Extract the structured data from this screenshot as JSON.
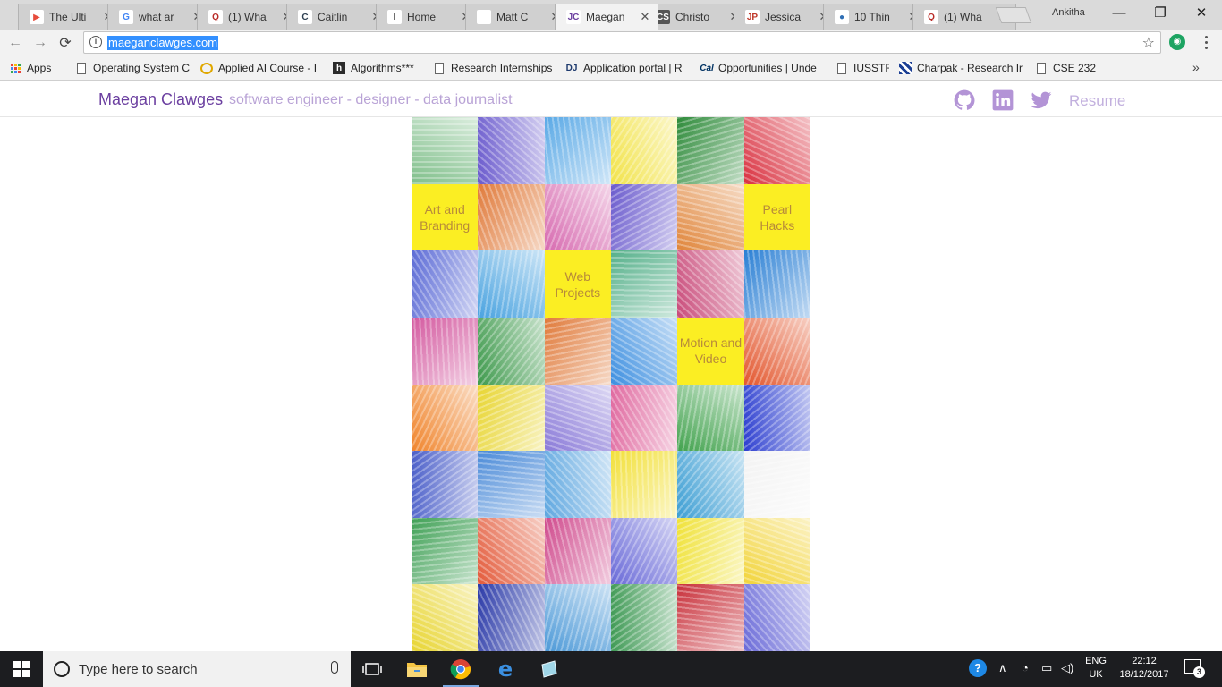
{
  "tabs": [
    {
      "title": "The Ulti",
      "favicon": "▶",
      "favbg": "#ffffff",
      "favcolor": "#e74c3c"
    },
    {
      "title": "what ar",
      "favicon": "G",
      "favbg": "#ffffff",
      "favcolor": "#4285f4"
    },
    {
      "title": "(1) Wha",
      "favicon": "Q",
      "favbg": "#ffffff",
      "favcolor": "#b92b27"
    },
    {
      "title": "Caitlin",
      "favicon": "C",
      "favbg": "#ffffff",
      "favcolor": "#2c3e50"
    },
    {
      "title": "Home",
      "favicon": "I",
      "favbg": "#ffffff",
      "favcolor": "#333333"
    },
    {
      "title": "Matt C",
      "favicon": "",
      "favbg": "#ffffff",
      "favcolor": "#333333"
    },
    {
      "title": "Maegan",
      "favicon": "JC",
      "favbg": "#ffffff",
      "favcolor": "#6b3fa0",
      "active": true
    },
    {
      "title": "Christo",
      "favicon": "CS",
      "favbg": "#555555",
      "favcolor": "#ffffff"
    },
    {
      "title": "Jessica",
      "favicon": "JP",
      "favbg": "#ffffff",
      "favcolor": "#c0392b"
    },
    {
      "title": "10 Thin",
      "favicon": "●",
      "favbg": "#ffffff",
      "favcolor": "#2f6fb5"
    },
    {
      "title": "(1) Wha",
      "favicon": "Q",
      "favbg": "#ffffff",
      "favcolor": "#b92b27"
    }
  ],
  "profile_name": "Ankitha",
  "window_controls": {
    "minimize": "—",
    "maximize": "❐",
    "close": "✕"
  },
  "address_bar": {
    "url": "maeganclawges.com",
    "info_glyph": "i",
    "star_glyph": "☆"
  },
  "nav": {
    "back": "←",
    "forward": "→",
    "reload": "⟳"
  },
  "bookmarks": [
    {
      "label": "Apps",
      "icon": "apps-grid"
    },
    {
      "label": "Operating System Co",
      "icon": "page"
    },
    {
      "label": "Applied AI Course - I",
      "icon": "circle"
    },
    {
      "label": "Algorithms***",
      "icon": "h"
    },
    {
      "label": "Research Internships",
      "icon": "page"
    },
    {
      "label": "Application portal | R",
      "icon": "DJ"
    },
    {
      "label": "Opportunities | Unde",
      "icon": "Cal"
    },
    {
      "label": "IUSSTF",
      "icon": "page"
    },
    {
      "label": "Charpak - Research Ir",
      "icon": "grid"
    },
    {
      "label": "CSE 232",
      "icon": "page"
    }
  ],
  "bookmarks_more": "»",
  "site": {
    "name": "Maegan Clawges",
    "tagline": "software engineer - designer - data journalist",
    "resume": "Resume",
    "colors": {
      "name": "#6b3fa0",
      "tagline": "#b9a3d6",
      "icons": "#b394d6"
    }
  },
  "mosaic_labels": {
    "art": "Art and Branding",
    "pearl": "Pearl Hacks",
    "web": "Web Projects",
    "motion": "Motion and Video"
  },
  "taskbar": {
    "search_placeholder": "Type here to search",
    "lang": "ENG",
    "region": "UK",
    "time": "22:12",
    "date": "18/12/2017",
    "notifications": "3"
  }
}
